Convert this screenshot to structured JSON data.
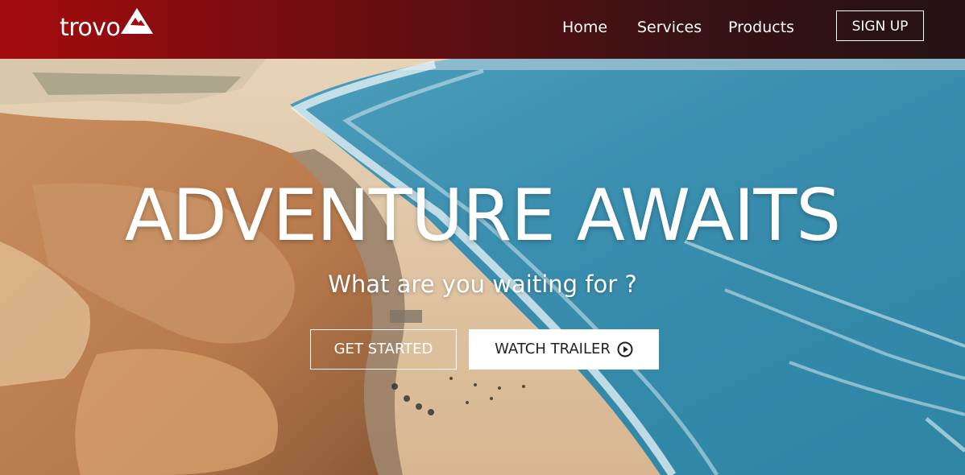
{
  "brand": {
    "name": "trovo",
    "logo_icon": "mountain-icon"
  },
  "nav": {
    "links": [
      {
        "label": "Home"
      },
      {
        "label": "Services"
      },
      {
        "label": "Products"
      }
    ],
    "signup_label": "SIGN UP"
  },
  "hero": {
    "headline": "ADVENTURE AWAITS",
    "subheadline": "What are you waiting for ?",
    "primary_button": "GET STARTED",
    "secondary_button": "WATCH TRAILER",
    "secondary_icon": "play-circle-icon",
    "background": "aerial-beach-cliffs-image"
  },
  "colors": {
    "nav_gradient_start": "#a50b0e",
    "nav_gradient_end": "#241214",
    "ocean": "#3a8fae",
    "sand": "#d9b48a"
  }
}
